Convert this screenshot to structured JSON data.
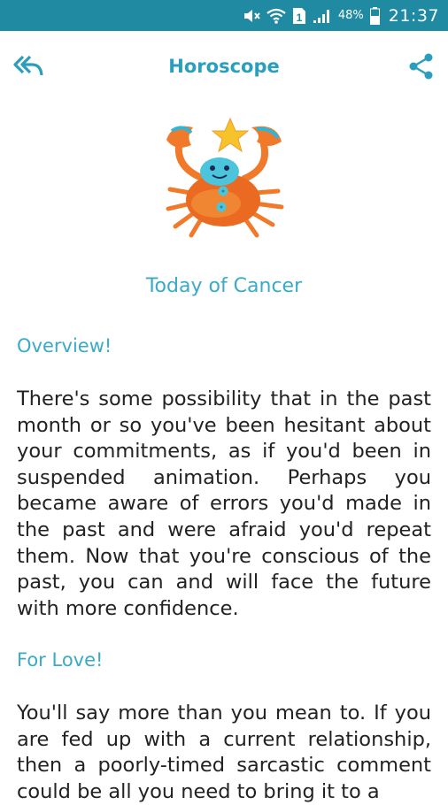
{
  "status_bar": {
    "battery_percent": "48%",
    "time": "21:37",
    "sim_slot": "1",
    "icons": [
      "mute-icon",
      "wifi-icon",
      "sim-icon",
      "signal-icon",
      "battery-icon"
    ]
  },
  "header": {
    "title": "Horoscope",
    "back_icon": "reply-arrow-icon",
    "share_icon": "share-icon"
  },
  "sign": {
    "image": "cancer-crab-illustration",
    "title": "Today of Cancer"
  },
  "sections": [
    {
      "title": "Overview!",
      "body": "There's some possibility that in the past month or so you've been hesitant about your commitments, as if you'd been in suspended animation. Perhaps you became aware of errors you'd made in the past and were afraid you'd repeat them. Now that you're conscious of the past, you can and will face the future with more confidence."
    },
    {
      "title": "For Love!",
      "body": "You'll say more than you mean to. If you are fed up with a current relationship, then a poorly-timed sarcastic comment could be all you need to bring it to a"
    }
  ],
  "colors": {
    "status_bar": "#1f8aa2",
    "accent": "#2a9fbd",
    "section_title": "#3aaac6",
    "body_text": "#222222"
  }
}
